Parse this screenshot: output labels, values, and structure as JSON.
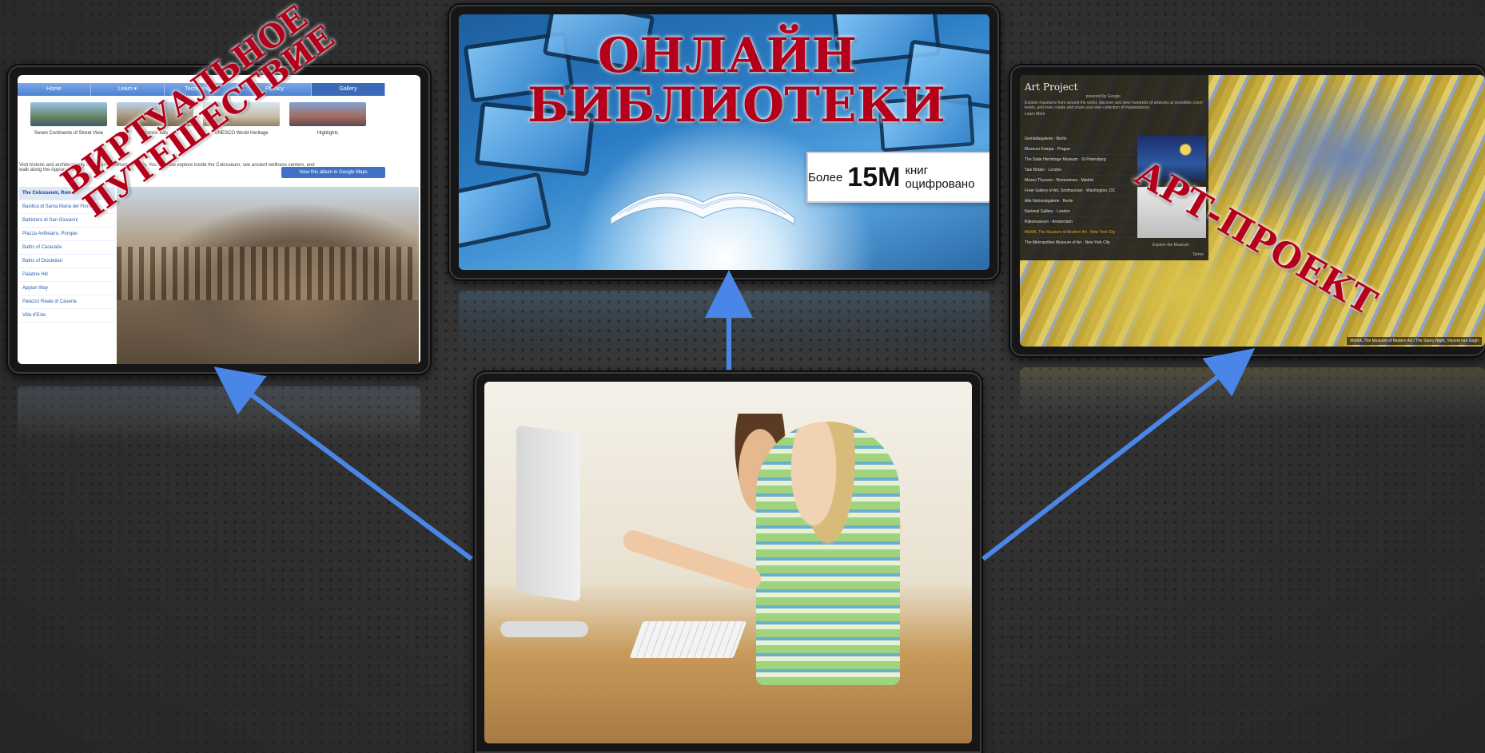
{
  "colors": {
    "arrow": "#4a86e8",
    "title_red": "#b5001b"
  },
  "library": {
    "title_line1": "ОНЛАЙН",
    "title_line2": "БИБЛИОТЕКИ",
    "badge_prefix": "Более",
    "badge_number": "15M",
    "badge_suffix": "книг оцифровано"
  },
  "virtual": {
    "title_line1": "ВИРТУАЛЬНОЕ",
    "title_line2": "ПУТЕШЕСТВИЕ",
    "nav": [
      "Home",
      "Learn ▾",
      "Technology ▾",
      "Privacy",
      "Gallery"
    ],
    "gallery": [
      "Seven Continents of Street View",
      "Historic Italy",
      "UNESCO World Heritage",
      "Highlights"
    ],
    "description": "Visit historic and architecturally significant landmarks in Italy. You can now explore inside the Colosseum, see ancient wellness centers, and walk along the Appian Way.",
    "button": "View this album in Google Maps",
    "places": [
      "The Colosseum, Rome",
      "Basilica di Santa Maria del Fiore",
      "Battistero di San Giovanni",
      "Piazza Anfiteatro, Pompei",
      "Baths of Caracalla",
      "Baths of Diocletian",
      "Palatine Hill",
      "Appian Way",
      "Palazzo Reale di Caserta",
      "Villa d'Este"
    ]
  },
  "art": {
    "title_line1": "АРТ-ПРОЕКТ",
    "panel_title": "Art Project",
    "powered": "powered by Google",
    "intro": "Explore museums from around the world, discover and view hundreds of artworks at incredible zoom levels, and even create and share your own collection of masterpieces.",
    "learn_more": "Learn More",
    "museums": [
      "Gemäldegalerie · Berlin",
      "Museum Kampa · Prague",
      "The State Hermitage Museum · St Petersburg",
      "Tate Britain · London",
      "Museo Thyssen - Bornemisza · Madrid",
      "Freer Gallery of Art, Smithsonian · Washington, DC",
      "Alte Nationalgalerie · Berlin",
      "National Gallery · London",
      "Rijksmuseum · Amsterdam",
      "MoMA, The Museum of Modern Art · New York City",
      "The Metropolitan Museum of Art · New York City"
    ],
    "explore": "Explore the Museum",
    "terms": "Terms",
    "caption": "MoMA, The Museum of Modern Art / The Starry Night, Vincent van Gogh"
  }
}
